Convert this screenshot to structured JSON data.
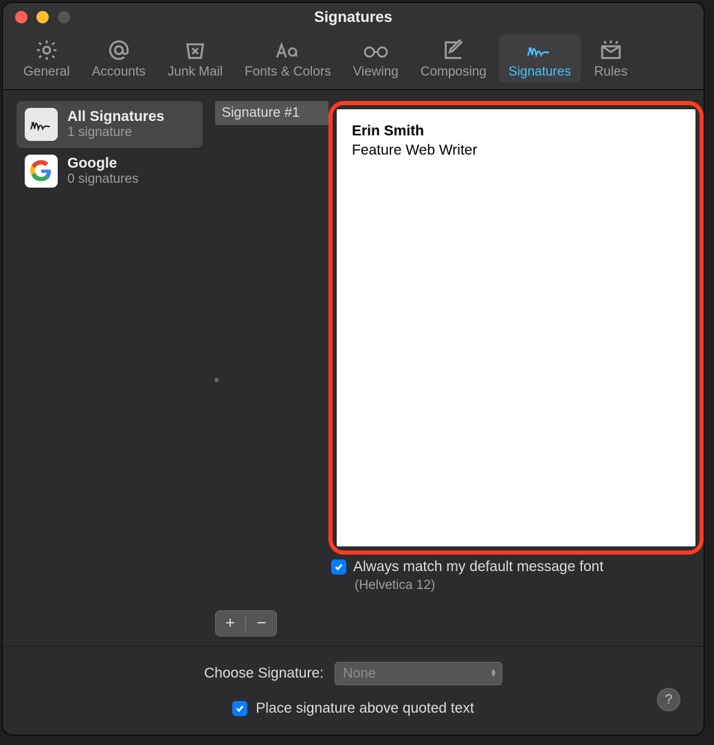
{
  "window": {
    "title": "Signatures"
  },
  "colors": {
    "accent": "#45c3ff",
    "highlight_border": "#ff3b20",
    "checkbox": "#0a7bff"
  },
  "toolbar": {
    "items": [
      {
        "label": "General"
      },
      {
        "label": "Accounts"
      },
      {
        "label": "Junk Mail"
      },
      {
        "label": "Fonts & Colors"
      },
      {
        "label": "Viewing"
      },
      {
        "label": "Composing"
      },
      {
        "label": "Signatures"
      },
      {
        "label": "Rules"
      }
    ],
    "active_index": 6
  },
  "sidebar": {
    "accounts": [
      {
        "name": "All Signatures",
        "subtitle": "1 signature",
        "icon": "signature-icon"
      },
      {
        "name": "Google",
        "subtitle": "0 signatures",
        "icon": "google-icon"
      }
    ],
    "selected_index": 0
  },
  "signature_list": {
    "items": [
      {
        "name": "Signature #1"
      }
    ],
    "selected_index": 0
  },
  "editor": {
    "line1": "Erin Smith",
    "line2": "Feature Web Writer"
  },
  "buttons": {
    "add": "+",
    "remove": "−"
  },
  "options": {
    "always_match_label": "Always match my default message font",
    "always_match_checked": true,
    "font_detail": "(Helvetica 12)"
  },
  "footer": {
    "choose_label": "Choose Signature:",
    "choose_value": "None",
    "place_above_label": "Place signature above quoted text",
    "place_above_checked": true
  },
  "help": {
    "label": "?"
  }
}
